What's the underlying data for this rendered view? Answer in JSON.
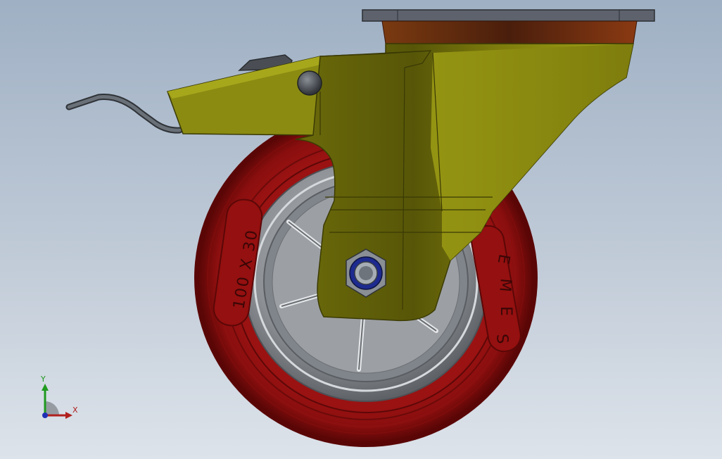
{
  "model": {
    "tire_size_text": "100 X 30",
    "brand_letters": [
      "E",
      "M",
      "E",
      "S"
    ],
    "colors": {
      "tire": "#a81414",
      "tire_dark": "#6e0a0a",
      "fork": "#8f8f10",
      "fork_dark": "#5c5a08",
      "top_plate": "#5a5f6a",
      "bearing_pad": "#7a3010",
      "hub": "#8e9297",
      "lever": "#555a60"
    }
  },
  "triad": {
    "x_label": "X",
    "y_label": "Y",
    "x_color": "#b0201e",
    "y_color": "#1f9a1f",
    "z_color": "#1f2fb5"
  }
}
